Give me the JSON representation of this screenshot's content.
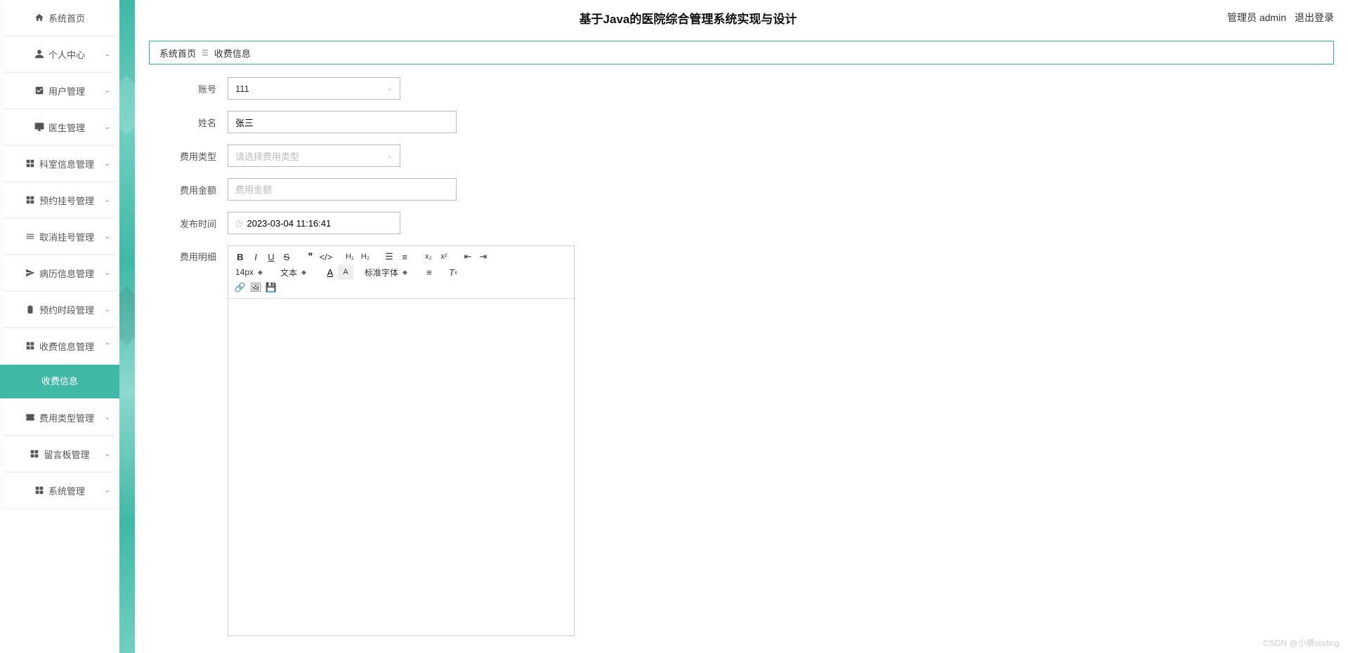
{
  "header": {
    "title": "基于Java的医院综合管理系统实现与设计",
    "role": "管理员 admin",
    "logout": "退出登录"
  },
  "breadcrumb": {
    "home": "系统首页",
    "current": "收费信息"
  },
  "sidebar": {
    "items": [
      {
        "icon": "home",
        "label": "系统首页",
        "arrow": false
      },
      {
        "icon": "user",
        "label": "个人中心",
        "arrow": true
      },
      {
        "icon": "check",
        "label": "用户管理",
        "arrow": true
      },
      {
        "icon": "desktop",
        "label": "医生管理",
        "arrow": true
      },
      {
        "icon": "grid",
        "label": "科室信息管理",
        "arrow": true
      },
      {
        "icon": "grid",
        "label": "预约挂号管理",
        "arrow": true
      },
      {
        "icon": "settings",
        "label": "取消挂号管理",
        "arrow": true
      },
      {
        "icon": "send",
        "label": "病历信息管理",
        "arrow": true
      },
      {
        "icon": "clipboard",
        "label": "预约时段管理",
        "arrow": true
      },
      {
        "icon": "grid",
        "label": "收费信息管理",
        "arrow": true,
        "open": true
      },
      {
        "icon": "ticket",
        "label": "费用类型管理",
        "arrow": true
      },
      {
        "icon": "grid",
        "label": "留言板管理",
        "arrow": true
      },
      {
        "icon": "grid",
        "label": "系统管理",
        "arrow": true
      }
    ],
    "sub_active": "收费信息"
  },
  "form": {
    "account": {
      "label": "账号",
      "value": "111"
    },
    "name": {
      "label": "姓名",
      "value": "张三"
    },
    "fee_type": {
      "label": "费用类型",
      "placeholder": "请选择费用类型"
    },
    "amount": {
      "label": "费用金额",
      "placeholder": "费用金额"
    },
    "publish_time": {
      "label": "发布时间",
      "value": "2023-03-04 11:16:41"
    },
    "detail": {
      "label": "费用明细"
    }
  },
  "editor_toolbar": {
    "font_size": "14px",
    "text_label": "文本",
    "font_family": "标准字体"
  },
  "watermark": "CSDN @小蔡coding"
}
